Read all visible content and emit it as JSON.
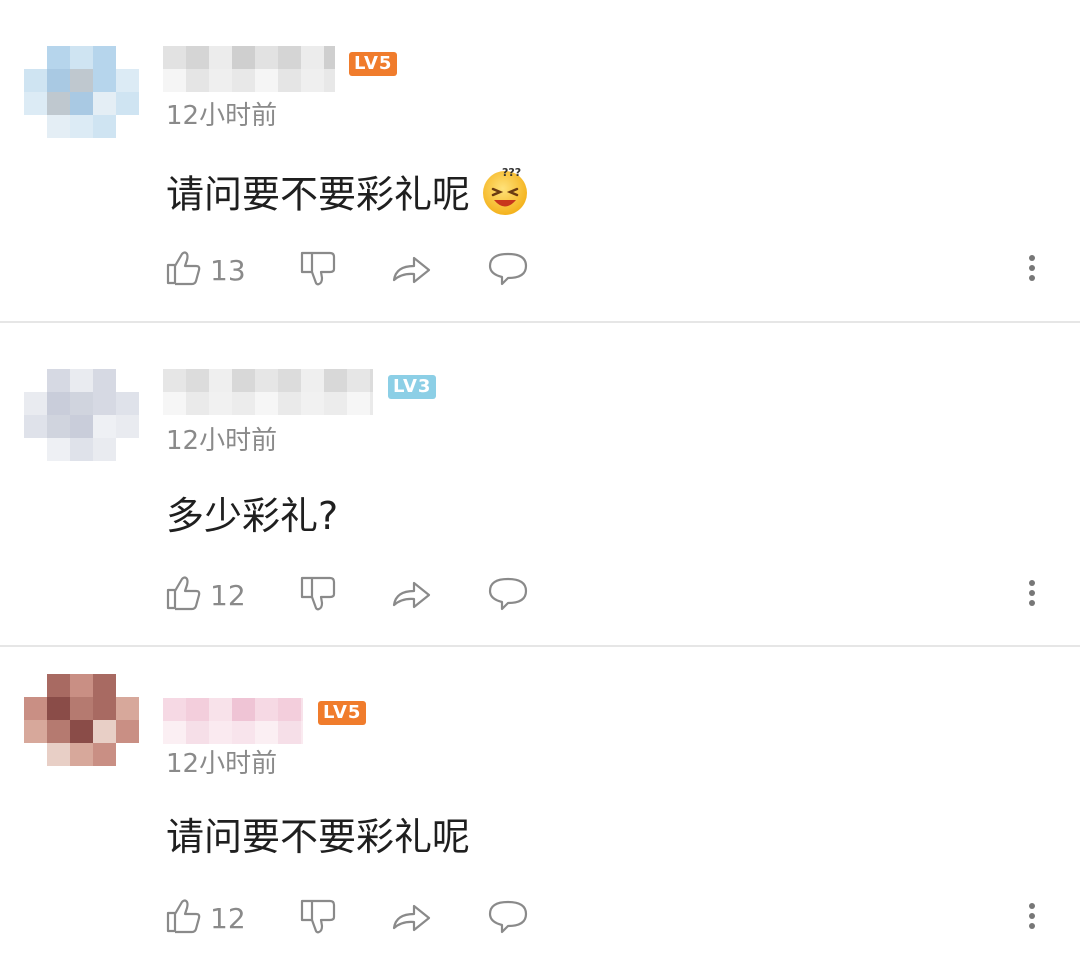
{
  "comments": [
    {
      "level": "LV5",
      "level_color": "#f07c2c",
      "time": "12小时前",
      "text": "请问要不要彩礼呢",
      "emoji": "confused-grin-emoji",
      "likes": "13",
      "avatar_palette": [
        "#cfe4f2",
        "#b6d5ec",
        "#dcebf5",
        "#a9c9e3",
        "#e4eef5",
        "#bfc8cf"
      ],
      "name_palette": [
        "#e2e2e2",
        "#d5d5d5",
        "#ececec",
        "#cfcfcf"
      ]
    },
    {
      "level": "LV3",
      "level_color": "#8ccfe6",
      "time": "12小时前",
      "text": "多少彩礼?",
      "likes": "12",
      "avatar_palette": [
        "#e9ebf0",
        "#d6d9e3",
        "#dfe2ea",
        "#c9cdda",
        "#eef0f4",
        "#d0d4de"
      ],
      "name_palette": [
        "#e6e6e6",
        "#dcdcdc",
        "#efefef",
        "#d8d8d8"
      ]
    },
    {
      "level": "LV5",
      "level_color": "#f07c2c",
      "time": "12小时前",
      "text": "请问要不要彩礼呢",
      "likes": "12",
      "avatar_palette": [
        "#c98f84",
        "#a86a62",
        "#d7a89b",
        "#8a4c48",
        "#e8cfc6",
        "#b57a70"
      ],
      "name_palette": [
        "#f6d9e4",
        "#f3cedc",
        "#f8e2ea",
        "#efc4d5"
      ]
    }
  ],
  "icons": {
    "like": "thumbs-up-icon",
    "dislike": "thumbs-down-icon",
    "share": "share-arrow-icon",
    "reply": "speech-bubble-icon",
    "more": "more-vertical-icon"
  }
}
